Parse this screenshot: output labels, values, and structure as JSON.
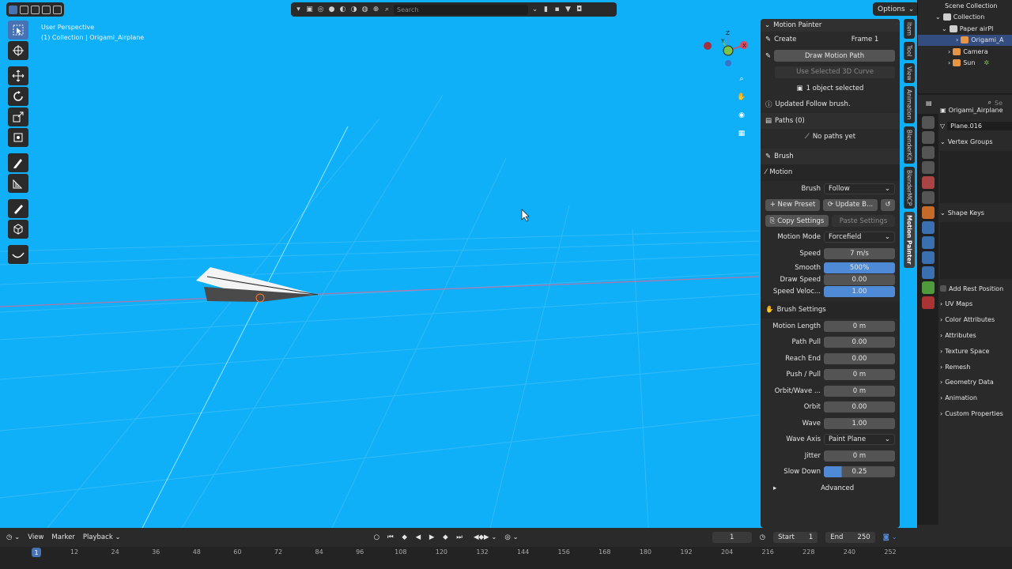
{
  "viewport": {
    "info_line1": "User Perspective",
    "info_line2": "(1) Collection | Origami_Airplane",
    "search_placeholder": "Search",
    "options_label": "Options",
    "gizmo": {
      "z": "Z",
      "y": "Y",
      "x": "X"
    },
    "bg_color": "#0fb0f8"
  },
  "npanel": {
    "title": "Motion Painter",
    "create_label": "Create",
    "frame_label": "Frame 1",
    "draw_motion_path": "Draw Motion Path",
    "use_selected_curve": "Use Selected 3D Curve",
    "objects_selected": "1 object selected",
    "status": "Updated Follow brush.",
    "paths_label": "Paths (0)",
    "no_paths": "No paths yet",
    "brush_label": "Brush",
    "motion_label": "Motion",
    "brush_field_label": "Brush",
    "brush_value": "Follow",
    "new_preset": "New Preset",
    "update_brush": "Update B...",
    "copy_settings": "Copy Settings",
    "paste_settings": "Paste Settings",
    "motion_mode_label": "Motion Mode",
    "motion_mode_value": "Forcefield",
    "speed_label": "Speed",
    "speed_value": "7 m/s",
    "smooth_label": "Smooth",
    "smooth_value": "500%",
    "draw_speed_label": "Draw Speed",
    "draw_speed_value": "0.00",
    "speed_veloc_label": "Speed Veloc...",
    "speed_veloc_value": "1.00",
    "brush_settings_label": "Brush Settings",
    "motion_length_label": "Motion Length",
    "motion_length_value": "0 m",
    "path_pull_label": "Path Pull",
    "path_pull_value": "0.00",
    "reach_end_label": "Reach End",
    "reach_end_value": "0.00",
    "push_pull_label": "Push / Pull",
    "push_pull_value": "0 m",
    "orbit_wave_label": "Orbit/Wave ...",
    "orbit_wave_value": "0 m",
    "orbit_label": "Orbit",
    "orbit_value": "0.00",
    "wave_label": "Wave",
    "wave_value": "1.00",
    "wave_axis_label": "Wave Axis",
    "wave_axis_value": "Paint Plane",
    "jitter_label": "Jitter",
    "jitter_value": "0 m",
    "slow_down_label": "Slow Down",
    "slow_down_value": "0.25",
    "slow_down_fraction": 0.25,
    "advanced_label": "Advanced"
  },
  "side_tabs": [
    "Item",
    "Tool",
    "View",
    "Animation",
    "BlenderKit",
    "BlenderMCP",
    "Motion Painter"
  ],
  "outliner": {
    "root": "Scene Collection",
    "collection": "Collection",
    "paper": "Paper airPl",
    "origami": "Origami_A",
    "camera": "Camera",
    "sun": "Sun"
  },
  "properties": {
    "search_placeholder": "Se",
    "object_name": "Origami_Airplane",
    "mesh_name": "Plane.016",
    "vertex_groups": "Vertex Groups",
    "shape_keys": "Shape Keys",
    "add_rest_position": "Add Rest Position",
    "uv_maps": "UV Maps",
    "color_attributes": "Color Attributes",
    "attributes": "Attributes",
    "texture_space": "Texture Space",
    "remesh": "Remesh",
    "geometry_data": "Geometry Data",
    "animation": "Animation",
    "custom_properties": "Custom Properties"
  },
  "timeline": {
    "view": "View",
    "marker": "Marker",
    "playback": "Playback",
    "current_frame": "1",
    "start_label": "Start",
    "start_value": "1",
    "end_label": "End",
    "end_value": "250",
    "ticks": [
      "12",
      "24",
      "36",
      "48",
      "60",
      "72",
      "84",
      "96",
      "108",
      "120",
      "132",
      "144",
      "156",
      "168",
      "180",
      "192",
      "204",
      "216",
      "228",
      "240",
      "252"
    ],
    "playhead": "1"
  }
}
